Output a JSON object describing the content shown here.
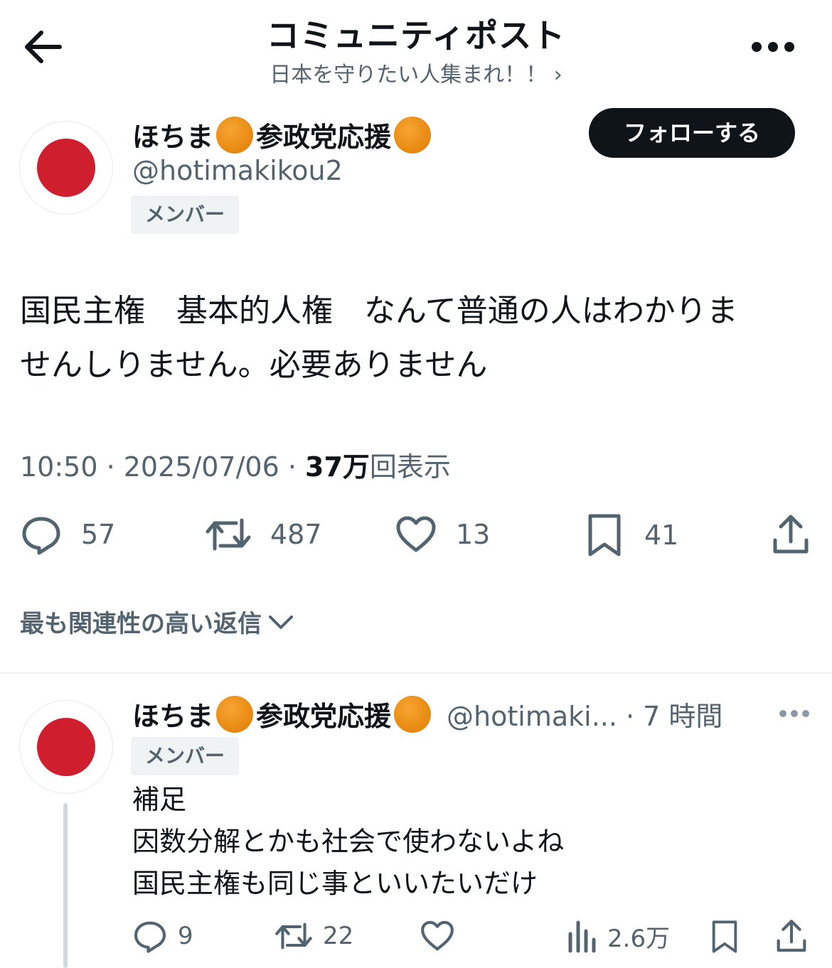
{
  "header": {
    "title": "コミュニティポスト",
    "subtitle": "日本を守りたい人集まれ！！ ›"
  },
  "post": {
    "display_name": "ほちま",
    "display_name_suffix": "参政党応援",
    "handle": "@hotimakikou2",
    "badge": "メンバー",
    "follow_label": "フォローする",
    "text_line1": "国民主権　基本的人権　なんて普通の人はわかりま",
    "text_line2": "せんしりません。必要ありません",
    "time": "10:50 · 2025/07/06 · ",
    "views_count": "37万",
    "views_label": "回表示",
    "stats": {
      "replies": "57",
      "reposts": "487",
      "likes": "13",
      "bookmarks": "41"
    }
  },
  "sort_label": "最も関連性の高い返信",
  "reply": {
    "display_name": "ほちま",
    "display_name_suffix": "参政党応援",
    "handle_time": "@hotimaki... · 7 時間",
    "badge": "メンバー",
    "text_lines": [
      "補足",
      "因数分解とかも社会で使わないよね",
      "国民主権も同じ事といいたいだけ"
    ],
    "stats": {
      "replies": "9",
      "reposts": "22",
      "views": "2.6万"
    }
  },
  "colors": {
    "text": "#0f1419",
    "muted": "#536471",
    "flag_red": "#cf1f2e",
    "orange_dot": "#f0900f",
    "badge_bg": "#eff3f4"
  }
}
